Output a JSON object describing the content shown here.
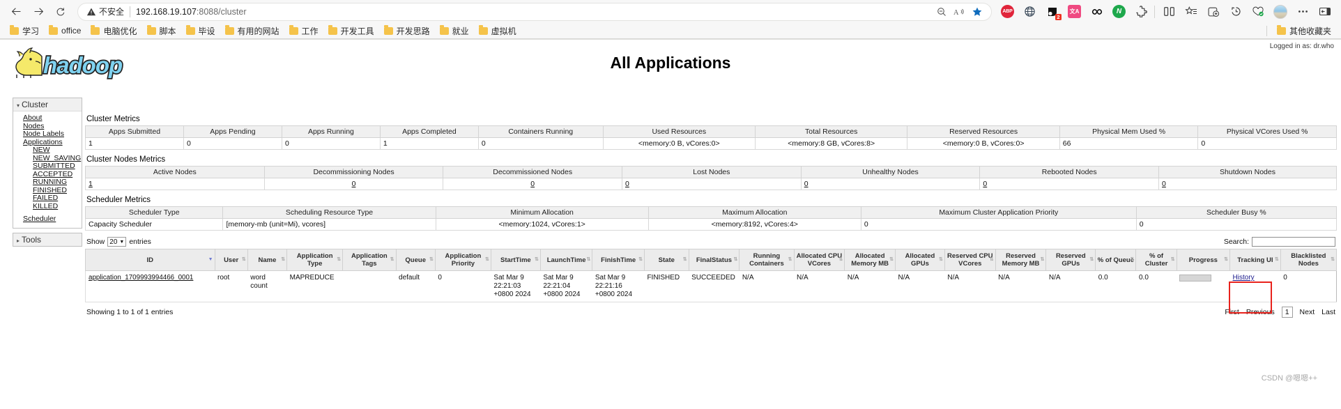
{
  "browser": {
    "back_icon": "back-arrow-icon",
    "forward_icon": "forward-arrow-icon",
    "reload_icon": "reload-icon",
    "security_label": "不安全",
    "url_host": "192.168.19.107",
    "url_rest": ":8088/cluster",
    "zoom_out_icon": "zoom-out-icon",
    "read_aloud_icon": "read-aloud-icon",
    "favorite_icon": "star-filled-icon",
    "extensions": [
      {
        "name": "adblock-plus-extension",
        "label": "ABP",
        "badge": ""
      },
      {
        "name": "globe-extension",
        "label": "",
        "badge": ""
      },
      {
        "name": "clipboard-extension",
        "label": "",
        "badge": "2"
      },
      {
        "name": "translate-extension",
        "label": "文A",
        "badge": ""
      },
      {
        "name": "infinity-extension",
        "label": "",
        "badge": ""
      },
      {
        "name": "note-extension",
        "label": "N",
        "badge": ""
      },
      {
        "name": "puzzle-extension",
        "label": "",
        "badge": ""
      }
    ],
    "split_screen_icon": "split-screen-icon",
    "collections_icon": "collections-icon",
    "add_favorite_icon": "add-favorite-icon",
    "history_icon": "history-icon",
    "performance_icon": "performance-icon",
    "profile_icon": "profile-avatar",
    "more_icon": "more-options-icon",
    "sidebar_icon": "sidebar-toggle-icon",
    "bookmarks": [
      "学习",
      "office",
      "电脑优化",
      "脚本",
      "毕设",
      "有用的网站",
      "工作",
      "开发工具",
      "开发思路",
      "就业",
      "虚拟机"
    ],
    "other_bookmarks": "其他收藏夹"
  },
  "page": {
    "title": "All Applications",
    "logged_in": "Logged in as: dr.who",
    "logo_text": "hadoop",
    "watermark": "CSDN @嗯嗯++"
  },
  "sidebar": {
    "cluster_label": "Cluster",
    "cluster_links": [
      "About",
      "Nodes",
      "Node Labels",
      "Applications"
    ],
    "app_states": [
      "NEW",
      "NEW_SAVING",
      "SUBMITTED",
      "ACCEPTED",
      "RUNNING",
      "FINISHED",
      "FAILED",
      "KILLED"
    ],
    "scheduler_label": "Scheduler",
    "tools_label": "Tools"
  },
  "cluster_metrics": {
    "title": "Cluster Metrics",
    "headers": [
      "Apps Submitted",
      "Apps Pending",
      "Apps Running",
      "Apps Completed",
      "Containers Running",
      "Used Resources",
      "Total Resources",
      "Reserved Resources",
      "Physical Mem Used %",
      "Physical VCores Used %"
    ],
    "values": [
      "1",
      "0",
      "0",
      "1",
      "0",
      "<memory:0 B, vCores:0>",
      "<memory:8 GB, vCores:8>",
      "<memory:0 B, vCores:0>",
      "66",
      "0"
    ]
  },
  "cluster_nodes_metrics": {
    "title": "Cluster Nodes Metrics",
    "headers": [
      "Active Nodes",
      "Decommissioning Nodes",
      "Decommissioned Nodes",
      "Lost Nodes",
      "Unhealthy Nodes",
      "Rebooted Nodes",
      "Shutdown Nodes"
    ],
    "values": [
      "1",
      "0",
      "0",
      "0",
      "0",
      "0",
      "0"
    ]
  },
  "scheduler_metrics": {
    "title": "Scheduler Metrics",
    "headers": [
      "Scheduler Type",
      "Scheduling Resource Type",
      "Minimum Allocation",
      "Maximum Allocation",
      "Maximum Cluster Application Priority",
      "Scheduler Busy %"
    ],
    "values": [
      "Capacity Scheduler",
      "[memory-mb (unit=Mi), vcores]",
      "<memory:1024, vCores:1>",
      "<memory:8192, vCores:4>",
      "0",
      "0"
    ]
  },
  "apps_table": {
    "show_label": "Show",
    "entries_count": "20",
    "entries_label": "entries",
    "search_label": "Search:",
    "search_value": "",
    "headers": [
      "ID",
      "User",
      "Name",
      "Application Type",
      "Application Tags",
      "Queue",
      "Application Priority",
      "StartTime",
      "LaunchTime",
      "FinishTime",
      "State",
      "FinalStatus",
      "Running Containers",
      "Allocated CPU VCores",
      "Allocated Memory MB",
      "Allocated GPUs",
      "Reserved CPU VCores",
      "Reserved Memory MB",
      "Reserved GPUs",
      "% of Queue",
      "% of Cluster",
      "Progress",
      "Tracking UI",
      "Blacklisted Nodes"
    ],
    "rows": [
      {
        "id": "application_1709993994466_0001",
        "user": "root",
        "name": "word count",
        "application_type": "MAPREDUCE",
        "application_tags": "",
        "queue": "default",
        "application_priority": "0",
        "start_time": "Sat Mar 9 22:21:03 +0800 2024",
        "launch_time": "Sat Mar 9 22:21:04 +0800 2024",
        "finish_time": "Sat Mar 9 22:21:16 +0800 2024",
        "state": "FINISHED",
        "final_status": "SUCCEEDED",
        "running_containers": "N/A",
        "allocated_cpu_vcores": "N/A",
        "allocated_memory_mb": "N/A",
        "allocated_gpus": "N/A",
        "reserved_cpu_vcores": "N/A",
        "reserved_memory_mb": "N/A",
        "reserved_gpus": "N/A",
        "pct_of_queue": "0.0",
        "pct_of_cluster": "0.0",
        "progress": "",
        "tracking_ui": "History",
        "blacklisted_nodes": "0"
      }
    ],
    "footer_info": "Showing 1 to 1 of 1 entries",
    "pager": {
      "first": "First",
      "previous": "Previous",
      "page": "1",
      "next": "Next",
      "last": "Last"
    }
  }
}
